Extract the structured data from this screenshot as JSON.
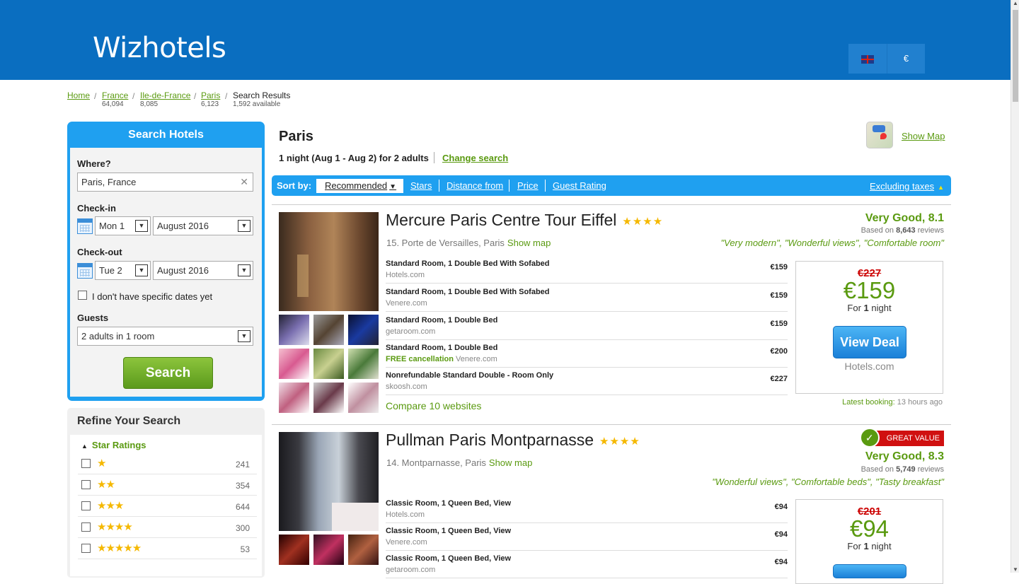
{
  "app": {
    "logo": "Wizhotels",
    "currency": "€"
  },
  "breadcrumb": [
    {
      "label": "Home",
      "count": ""
    },
    {
      "label": "France",
      "count": "64,094"
    },
    {
      "label": "Ile-de-France",
      "count": "8,085"
    },
    {
      "label": "Paris",
      "count": "6,123"
    },
    {
      "label": "Search Results",
      "count": "1,592 available"
    }
  ],
  "search": {
    "title": "Search Hotels",
    "where_label": "Where?",
    "where_value": "Paris, France",
    "checkin_label": "Check-in",
    "checkin_day": "Mon 1",
    "checkin_month": "August 2016",
    "checkout_label": "Check-out",
    "checkout_day": "Tue 2",
    "checkout_month": "August 2016",
    "nodates_label": "I don't have specific dates yet",
    "guests_label": "Guests",
    "guests_value": "2 adults in 1 room",
    "button": "Search"
  },
  "refine": {
    "title": "Refine Your Search",
    "star_heading": "Star Ratings",
    "stars": [
      {
        "stars": "★",
        "count": "241"
      },
      {
        "stars": "★★",
        "count": "354"
      },
      {
        "stars": "★★★",
        "count": "644"
      },
      {
        "stars": "★★★★",
        "count": "300"
      },
      {
        "stars": "★★★★★",
        "count": "53"
      }
    ]
  },
  "results": {
    "city": "Paris",
    "trip": "1 night (Aug 1 - Aug 2) for 2 adults",
    "change": "Change search",
    "show_map": "Show Map",
    "sort_label": "Sort by:",
    "sort_selected": "Recommended",
    "sort_links": [
      "Stars",
      "Distance from",
      "Price",
      "Guest Rating"
    ],
    "excluding": "Excluding taxes"
  },
  "hotels": [
    {
      "name": "Mercure Paris Centre Tour Eiffel",
      "stars": "★★★★",
      "address": "15. Porte de Versailles, Paris",
      "show_map": "Show map",
      "rating": "Very Good, 8.1",
      "based_pre": "Based on",
      "reviews": "8,643",
      "based_post": "reviews",
      "quotes": "\"Very modern\", \"Wonderful views\", \"Comfortable room\"",
      "rooms": [
        {
          "name": "Standard Room, 1 Double Bed With Sofabed",
          "free": "",
          "site": "Hotels.com",
          "price": "€159"
        },
        {
          "name": "Standard Room, 1 Double Bed With Sofabed",
          "free": "",
          "site": "Venere.com",
          "price": "€159"
        },
        {
          "name": "Standard Room, 1 Double Bed",
          "free": "",
          "site": "getaroom.com",
          "price": "€159"
        },
        {
          "name": "Standard Room, 1 Double Bed",
          "free": "FREE cancellation",
          "site": "Venere.com",
          "price": "€200"
        },
        {
          "name": "Nonrefundable Standard Double - Room Only",
          "free": "",
          "site": "skoosh.com",
          "price": "€227"
        }
      ],
      "old_price": "€227",
      "price": "€159",
      "for_pre": "For",
      "nights": "1",
      "for_post": "night",
      "deal_button": "View Deal",
      "deal_site": "Hotels.com",
      "compare": "Compare 10 websites",
      "latest_label": "Latest booking:",
      "latest_time": "13 hours ago"
    },
    {
      "name": "Pullman Paris Montparnasse",
      "stars": "★★★★",
      "badge": "GREAT VALUE",
      "address": "14. Montparnasse, Paris",
      "show_map": "Show map",
      "rating": "Very Good, 8.3",
      "based_pre": "Based on",
      "reviews": "5,749",
      "based_post": "reviews",
      "quotes": "\"Wonderful views\", \"Comfortable beds\", \"Tasty breakfast\"",
      "rooms": [
        {
          "name": "Classic Room, 1 Queen Bed, View",
          "free": "",
          "site": "Hotels.com",
          "price": "€94"
        },
        {
          "name": "Classic Room, 1 Queen Bed, View",
          "free": "",
          "site": "Venere.com",
          "price": "€94"
        },
        {
          "name": "Classic Room, 1 Queen Bed, View",
          "free": "",
          "site": "getaroom.com",
          "price": "€94"
        }
      ],
      "old_price": "€201",
      "price": "€94",
      "for_pre": "For",
      "nights": "1",
      "for_post": "night"
    }
  ]
}
